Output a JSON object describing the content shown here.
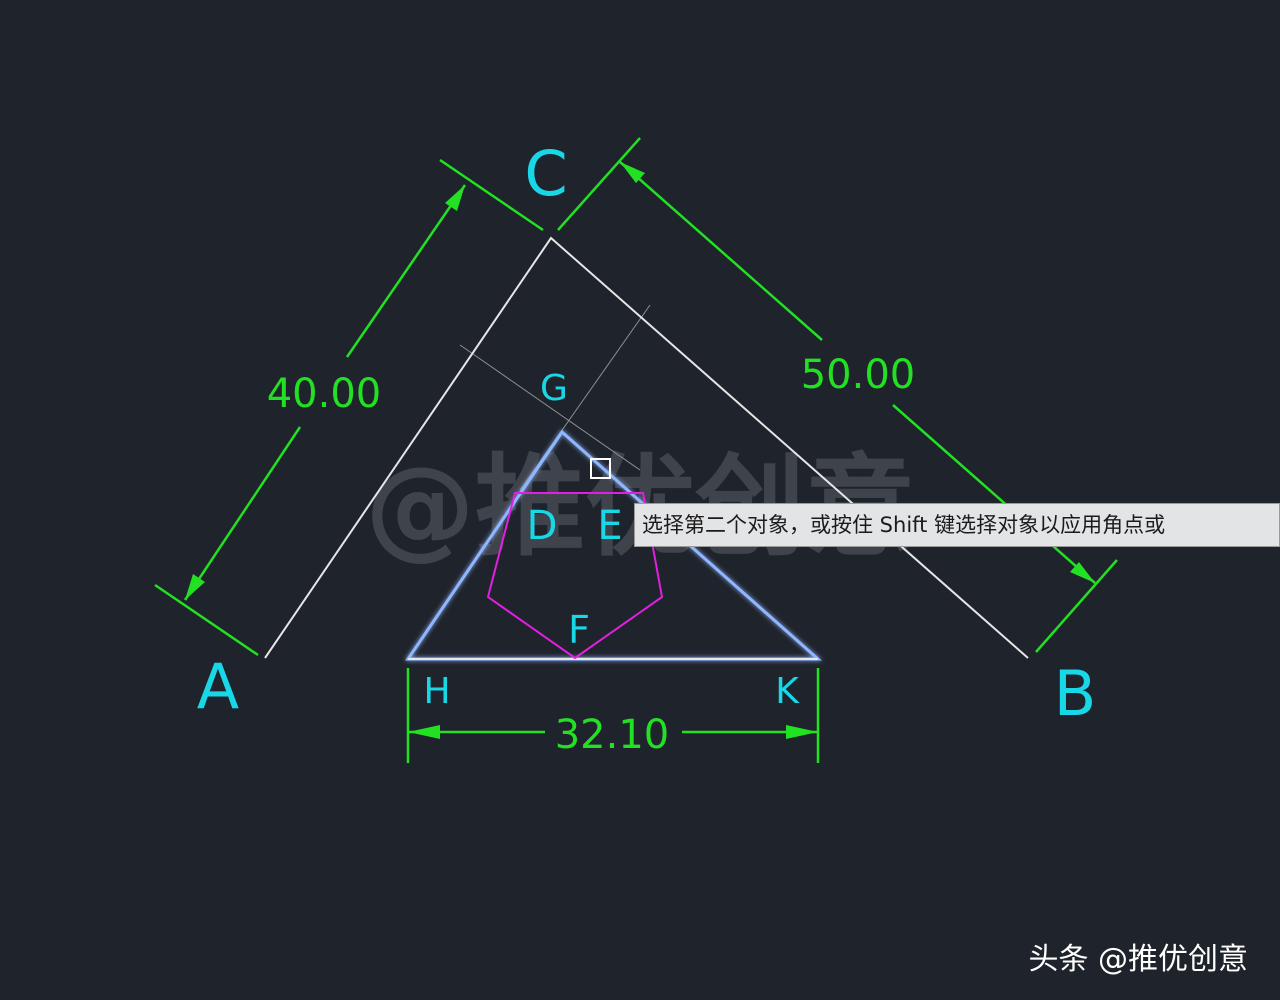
{
  "colors": {
    "background": "#1f232b",
    "geometry_line": "#e6e6e6",
    "dimension": "#22e022",
    "point_label": "#18d8e8",
    "selected_triangle": "#8fb6ff",
    "pentagon": "#e020e0",
    "construction": "#8a8f96",
    "watermark": "#5a5e66"
  },
  "points": {
    "A": "A",
    "B": "B",
    "C": "C",
    "D": "D",
    "E": "E",
    "F": "F",
    "G": "G",
    "H": "H",
    "K": "K"
  },
  "dimensions": {
    "ac": "40.00",
    "cb": "50.00",
    "hk": "32.10"
  },
  "watermark": "@推优创意",
  "tooltip": "选择第二个对象，或按住 Shift 键选择对象以应用角点或",
  "footer": "头条 @推优创意",
  "icons": [
    "pickbox-icon",
    "arrowhead-icon"
  ]
}
